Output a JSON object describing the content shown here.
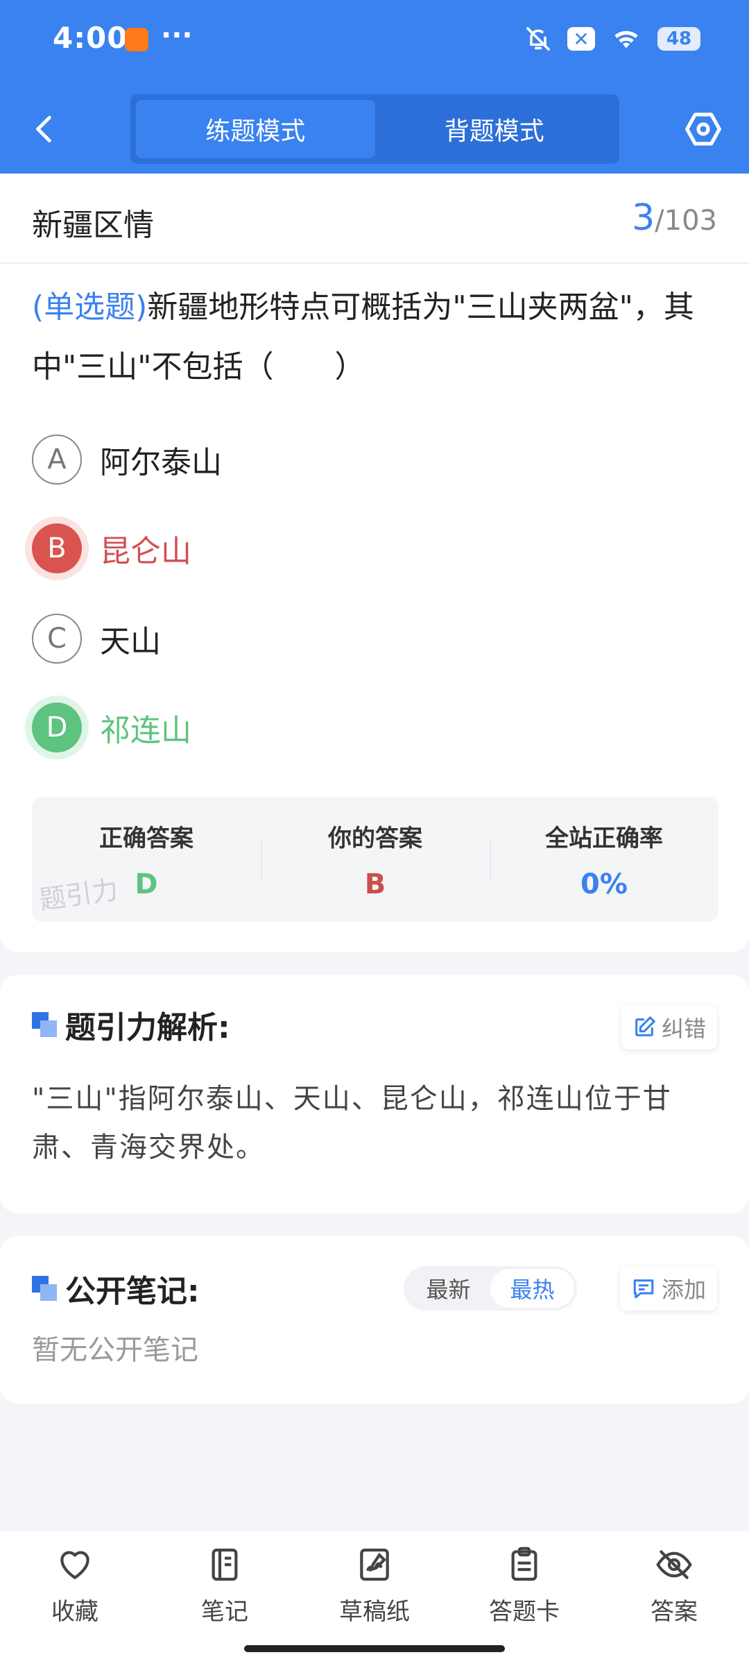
{
  "status_bar": {
    "time": "4:00",
    "dots": "···",
    "battery": "48",
    "icons": [
      "app-notification-icon",
      "bell-off-icon",
      "x-badge-icon",
      "wifi-icon",
      "battery-icon"
    ]
  },
  "nav": {
    "tabs": [
      {
        "label": "练题模式",
        "active": true
      },
      {
        "label": "背题模式",
        "active": false
      }
    ],
    "icons": [
      "back-chevron-icon",
      "settings-hexagon-icon"
    ]
  },
  "question": {
    "category": "新疆区情",
    "current": "3",
    "total": "/103",
    "type": "(单选题)",
    "text": "新疆地形特点可概括为\"三山夹两盆\"，其中\"三山\"不包括（　　）",
    "options": [
      {
        "letter": "A",
        "text": "阿尔泰山",
        "state": "normal"
      },
      {
        "letter": "B",
        "text": "昆仑山",
        "state": "wrong"
      },
      {
        "letter": "C",
        "text": "天山",
        "state": "normal"
      },
      {
        "letter": "D",
        "text": "祁连山",
        "state": "correct"
      }
    ]
  },
  "answer_summary": {
    "correct_label": "正确答案",
    "correct_value": "D",
    "yours_label": "你的答案",
    "yours_value": "B",
    "rate_label": "全站正确率",
    "rate_value": "0%",
    "watermark": "题引力"
  },
  "analysis": {
    "title": "题引力解析:",
    "report_label": "纠错",
    "text": "\"三山\"指阿尔泰山、天山、昆仑山，祁连山位于甘肃、青海交界处。"
  },
  "notes": {
    "title": "公开笔记:",
    "sort_options": [
      {
        "label": "最新",
        "active": false
      },
      {
        "label": "最热",
        "active": true
      }
    ],
    "add_label": "添加",
    "empty_text": "暂无公开笔记"
  },
  "bottom_bar": [
    {
      "label": "收藏",
      "icon": "heart-icon"
    },
    {
      "label": "笔记",
      "icon": "notebook-icon"
    },
    {
      "label": "草稿纸",
      "icon": "draft-paper-icon"
    },
    {
      "label": "答题卡",
      "icon": "answer-sheet-icon"
    },
    {
      "label": "答案",
      "icon": "eye-off-icon"
    }
  ],
  "colors": {
    "primary": "#3a82ef",
    "wrong": "#d9534f",
    "correct": "#5ec37e"
  }
}
